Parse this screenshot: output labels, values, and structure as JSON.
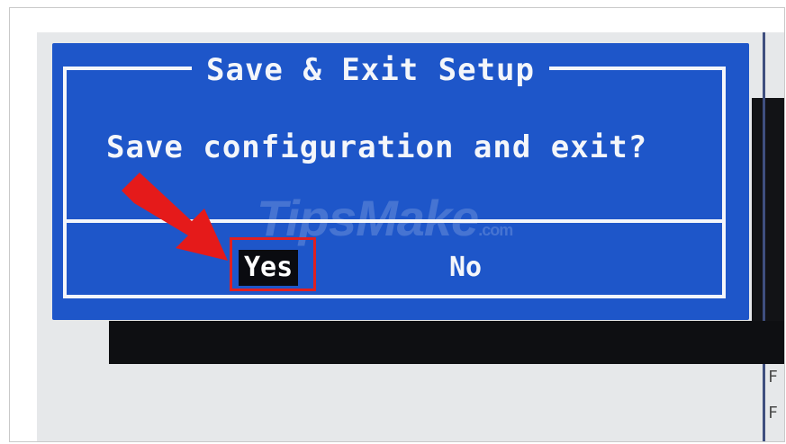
{
  "dialog": {
    "title": "Save & Exit Setup",
    "message": "Save configuration and exit?",
    "buttons": {
      "yes": "Yes",
      "no": "No"
    }
  },
  "side_help": [
    "F",
    "F"
  ],
  "watermark": {
    "brand": "TipsMake",
    "suffix": ".com"
  },
  "colors": {
    "dialog_bg": "#1e56c9",
    "dialog_fg": "#f4f6fa",
    "selected_bg": "#0a0b10",
    "annotation": "#e02020"
  },
  "icons": {
    "annotation_arrow": "red-arrow-icon"
  }
}
